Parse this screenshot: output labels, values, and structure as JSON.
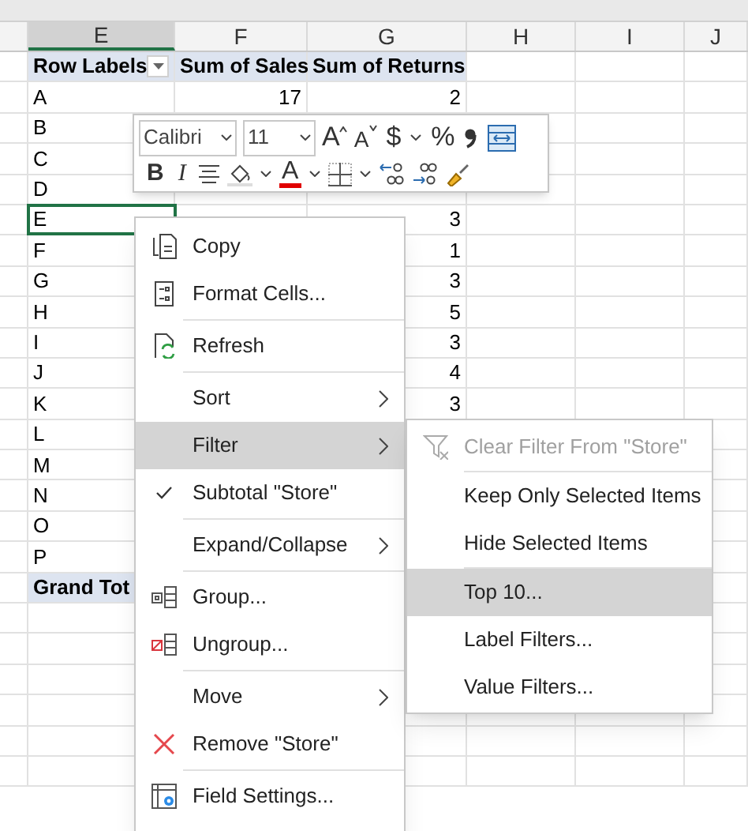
{
  "columns": [
    {
      "label": "E",
      "selected": true
    },
    {
      "label": "F",
      "selected": false
    },
    {
      "label": "G",
      "selected": false
    },
    {
      "label": "H",
      "selected": false
    },
    {
      "label": "I",
      "selected": false
    },
    {
      "label": "J",
      "selected": false
    }
  ],
  "pivot": {
    "headers": [
      "Row Labels",
      "Sum of Sales",
      "Sum of Returns"
    ],
    "rows": [
      {
        "label": "A",
        "sales": "17",
        "returns": "2",
        "selected": false
      },
      {
        "label": "B",
        "selected": false
      },
      {
        "label": "C",
        "selected": false
      },
      {
        "label": "D",
        "selected": false
      },
      {
        "label": "E",
        "returns": "3",
        "selected": true
      },
      {
        "label": "F",
        "returns": "1",
        "selected": false
      },
      {
        "label": "G",
        "returns": "3",
        "selected": false
      },
      {
        "label": "H",
        "returns": "5",
        "selected": false
      },
      {
        "label": "I",
        "returns": "3",
        "selected": false
      },
      {
        "label": "J",
        "returns": "4",
        "selected": false
      },
      {
        "label": "K",
        "returns": "3",
        "selected": false
      },
      {
        "label": "L",
        "selected": false
      },
      {
        "label": "M",
        "selected": false
      },
      {
        "label": "N",
        "selected": false
      },
      {
        "label": "O",
        "selected": false
      },
      {
        "label": "P",
        "selected": false
      }
    ],
    "total": {
      "label": "Grand Tot"
    }
  },
  "mini_toolbar": {
    "font": "Calibri",
    "size": "11",
    "row_1": [
      {
        "kind": "grow",
        "label": "A"
      },
      {
        "kind": "shrink",
        "label": "A"
      },
      {
        "kind": "text",
        "label": "$"
      },
      {
        "kind": "caret"
      },
      {
        "kind": "text",
        "label": "%"
      },
      {
        "kind": "comma"
      },
      {
        "kind": "wrap"
      }
    ],
    "row_2": [
      {
        "kind": "bold",
        "label": "B"
      },
      {
        "kind": "italic",
        "label": "I"
      },
      {
        "kind": "align"
      },
      {
        "kind": "fill"
      },
      {
        "kind": "caret"
      },
      {
        "kind": "font-color",
        "label": "A"
      },
      {
        "kind": "caret"
      },
      {
        "kind": "borders"
      },
      {
        "kind": "caret"
      },
      {
        "kind": "inc-decimal"
      },
      {
        "kind": "dec-decimal"
      },
      {
        "kind": "painter"
      }
    ]
  },
  "context_menu": [
    {
      "kind": "copy",
      "label": "Copy",
      "submenu": false,
      "checked": false,
      "selected": false,
      "separator_after": false
    },
    {
      "kind": "format",
      "label": "Format Cells...",
      "submenu": false,
      "checked": false,
      "selected": false,
      "separator_after": true
    },
    {
      "kind": "refresh",
      "label": "Refresh",
      "submenu": false,
      "checked": false,
      "selected": false,
      "separator_after": true
    },
    {
      "kind": "plain",
      "label": "Sort",
      "submenu": true,
      "checked": false,
      "selected": false,
      "separator_after": false
    },
    {
      "kind": "plain",
      "label": "Filter",
      "submenu": true,
      "checked": false,
      "selected": true,
      "separator_after": false
    },
    {
      "kind": "plain",
      "label": "Subtotal \"Store\"",
      "submenu": false,
      "checked": true,
      "selected": false,
      "separator_after": true
    },
    {
      "kind": "plain",
      "label": "Expand/Collapse",
      "submenu": true,
      "checked": false,
      "selected": false,
      "separator_after": true
    },
    {
      "kind": "group",
      "label": "Group...",
      "submenu": false,
      "checked": false,
      "selected": false,
      "separator_after": false
    },
    {
      "kind": "ungroup",
      "label": "Ungroup...",
      "submenu": false,
      "checked": false,
      "selected": false,
      "separator_after": true
    },
    {
      "kind": "plain",
      "label": "Move",
      "submenu": true,
      "checked": false,
      "selected": false,
      "separator_after": false
    },
    {
      "kind": "remove",
      "label": "Remove \"Store\"",
      "submenu": false,
      "checked": false,
      "selected": false,
      "separator_after": true
    },
    {
      "kind": "settings",
      "label": "Field Settings...",
      "submenu": false,
      "checked": false,
      "selected": false,
      "separator_after": false
    }
  ],
  "filter_submenu": [
    {
      "kind": "clear",
      "label": "Clear Filter From \"Store\"",
      "disabled": true,
      "selected": false,
      "separator_after": true
    },
    {
      "kind": "plain",
      "label": "Keep Only Selected Items",
      "disabled": false,
      "selected": false,
      "separator_after": false
    },
    {
      "kind": "plain",
      "label": "Hide Selected Items",
      "disabled": false,
      "selected": false,
      "separator_after": true
    },
    {
      "kind": "plain",
      "label": "Top 10...",
      "disabled": false,
      "selected": true,
      "separator_after": false
    },
    {
      "kind": "plain",
      "label": "Label Filters...",
      "disabled": false,
      "selected": false,
      "separator_after": false
    },
    {
      "kind": "plain",
      "label": "Value Filters...",
      "disabled": false,
      "selected": false,
      "separator_after": false
    }
  ]
}
